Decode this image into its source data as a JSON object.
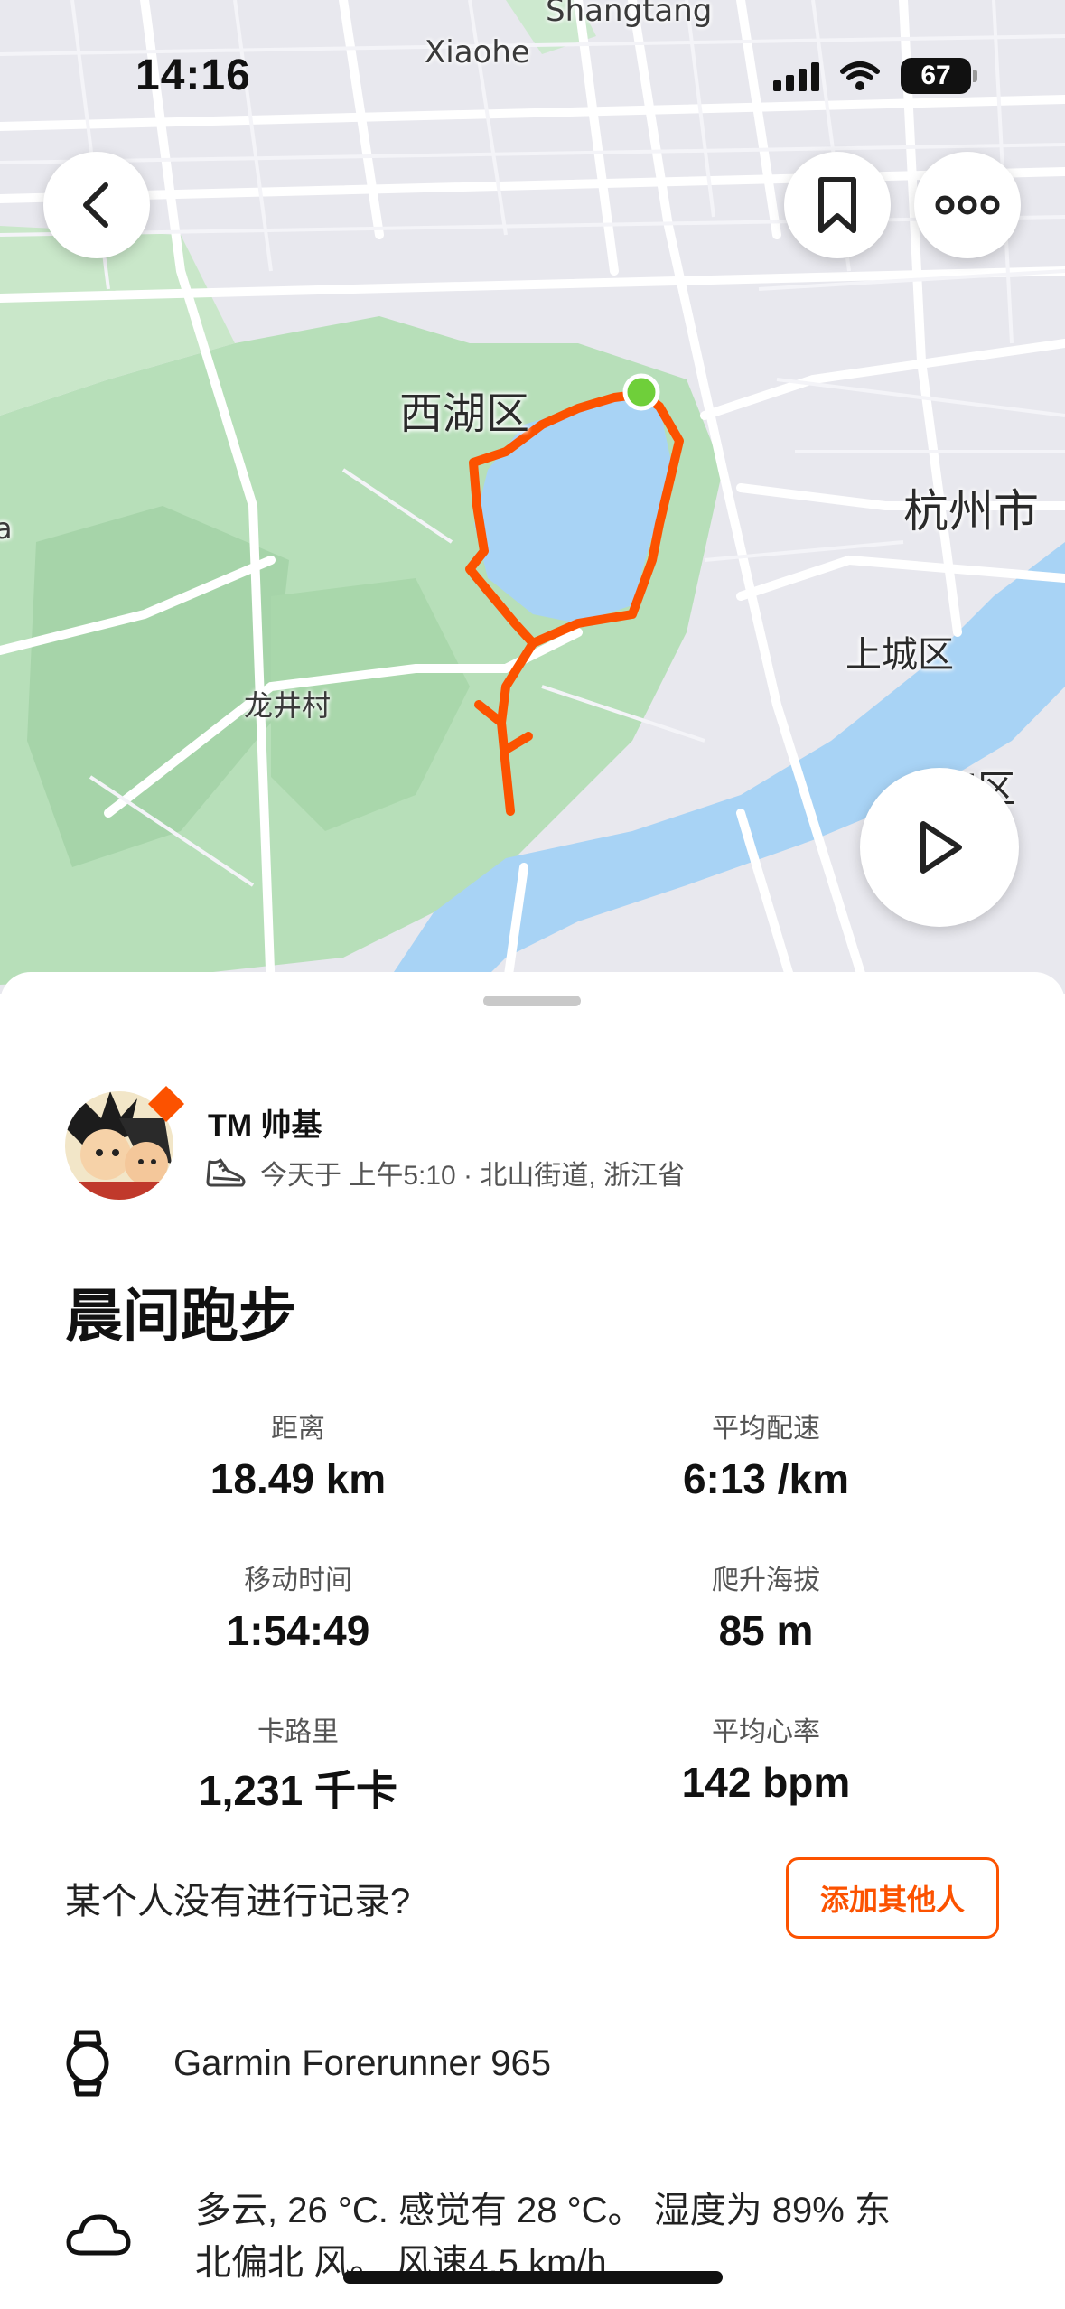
{
  "status_bar": {
    "time": "14:16",
    "battery": "67"
  },
  "map": {
    "labels": {
      "shangtang": "Shangtang",
      "xiaohe": "Xiaohe",
      "xihu": "西湖区",
      "hangzhou": "杭州市",
      "shangcheng": "上城区",
      "longjing": "龙井村",
      "jiangqu": "江区",
      "edge_a": "a"
    },
    "colors": {
      "route": "#fc5200",
      "start_dot": "#6fcf3a",
      "water": "#a8d3f5",
      "park": "#bfe3c2",
      "road": "#ffffff"
    }
  },
  "athlete": {
    "name": "TM 帅基"
  },
  "activity": {
    "meta": "今天于 上午5:10 · 北山街道, 浙江省",
    "title": "晨间跑步"
  },
  "stats": {
    "distance": {
      "label": "距离",
      "value": "18.49 km"
    },
    "avg_pace": {
      "label": "平均配速",
      "value": "6:13 /km"
    },
    "moving_time": {
      "label": "移动时间",
      "value": "1:54:49"
    },
    "elevation": {
      "label": "爬升海拔",
      "value": "85 m"
    },
    "calories": {
      "label": "卡路里",
      "value": "1,231 千卡"
    },
    "avg_hr": {
      "label": "平均心率",
      "value": "142 bpm"
    }
  },
  "add_others": {
    "question": "某个人没有进行记录?",
    "button_label": "添加其他人"
  },
  "device": {
    "name": "Garmin Forerunner 965"
  },
  "weather": {
    "text": "多云, 26 °C. 感觉有 28 °C。 湿度为 89% 东北偏北 风。 风速4.5 km/h"
  },
  "icons": [
    "back-icon",
    "bookmark-icon",
    "more-icon",
    "play-icon",
    "shoe-icon",
    "watch-icon",
    "cloud-icon"
  ],
  "accent_color": "#fc5200"
}
